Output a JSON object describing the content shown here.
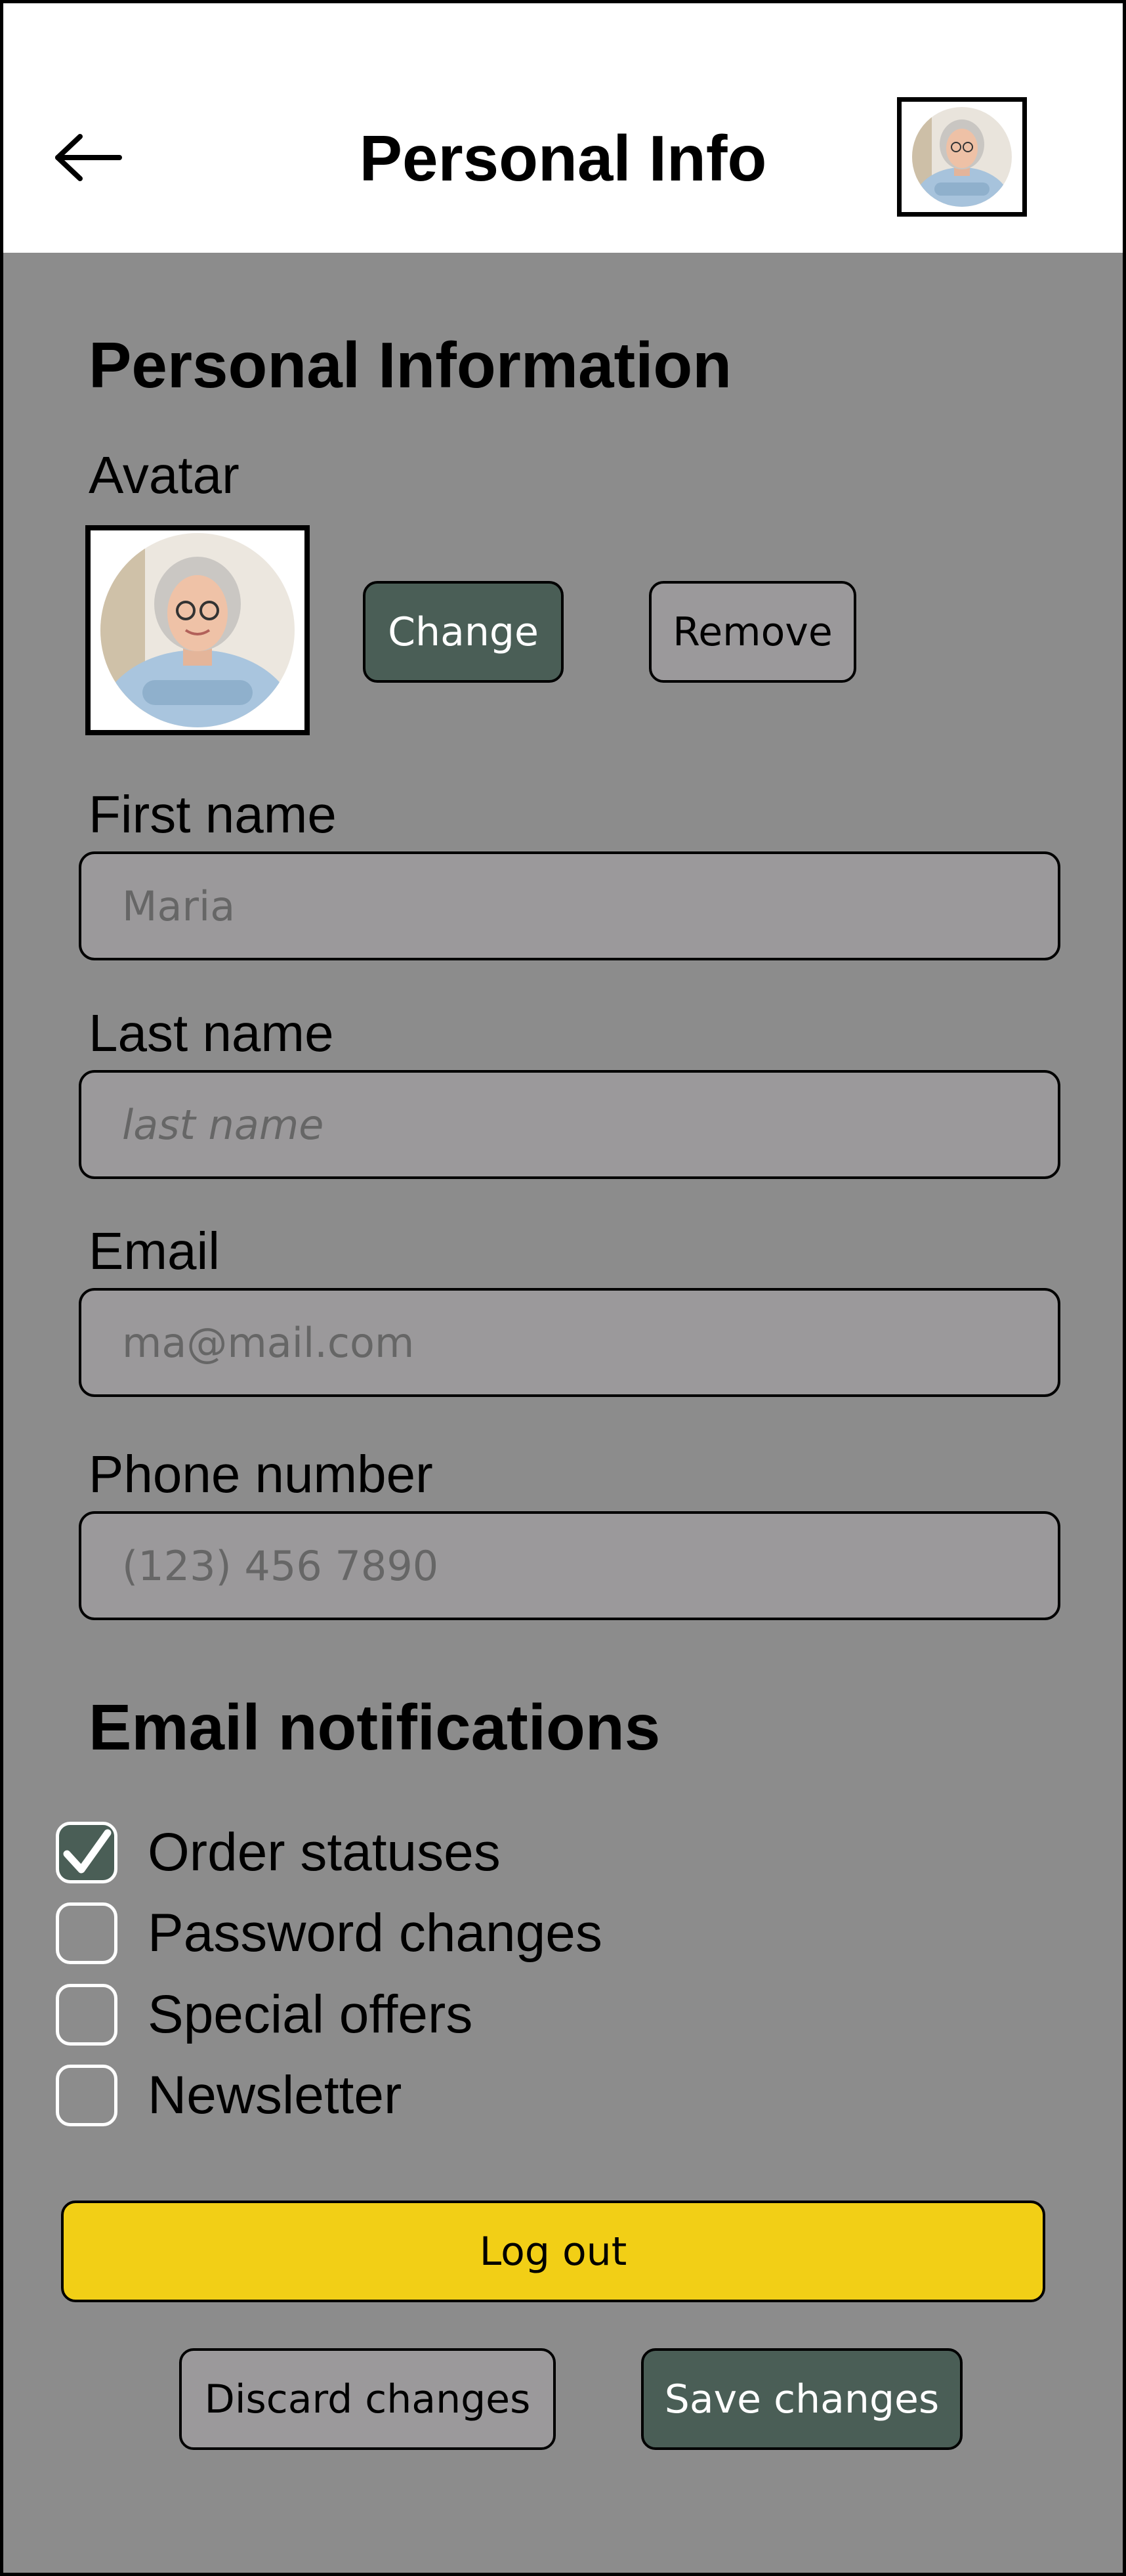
{
  "header": {
    "title": "Personal Info"
  },
  "personal": {
    "heading": "Personal Information",
    "avatar_label": "Avatar",
    "change_label": "Change",
    "remove_label": "Remove"
  },
  "fields": {
    "first_name": {
      "label": "First name",
      "value": "Maria"
    },
    "last_name": {
      "label": "Last name",
      "placeholder": "last name"
    },
    "email": {
      "label": "Email",
      "value": "ma@mail.com"
    },
    "phone": {
      "label": "Phone number",
      "value": "(123) 456 7890"
    }
  },
  "notifications": {
    "heading": "Email notifications",
    "items": [
      {
        "label": "Order statuses",
        "checked": true
      },
      {
        "label": "Password changes",
        "checked": false
      },
      {
        "label": "Special offers",
        "checked": false
      },
      {
        "label": "Newsletter",
        "checked": false
      }
    ]
  },
  "actions": {
    "logout_label": "Log out",
    "discard_label": "Discard changes",
    "save_label": "Save changes"
  },
  "colors": {
    "accent_dark": "#4a5e56",
    "accent_yellow": "#f2cf16",
    "content_bg": "#8c8c8c",
    "field_bg": "#9b999b"
  },
  "icons": {
    "back": "arrow-left-icon",
    "avatar": "user-photo",
    "check": "checkmark-icon"
  }
}
